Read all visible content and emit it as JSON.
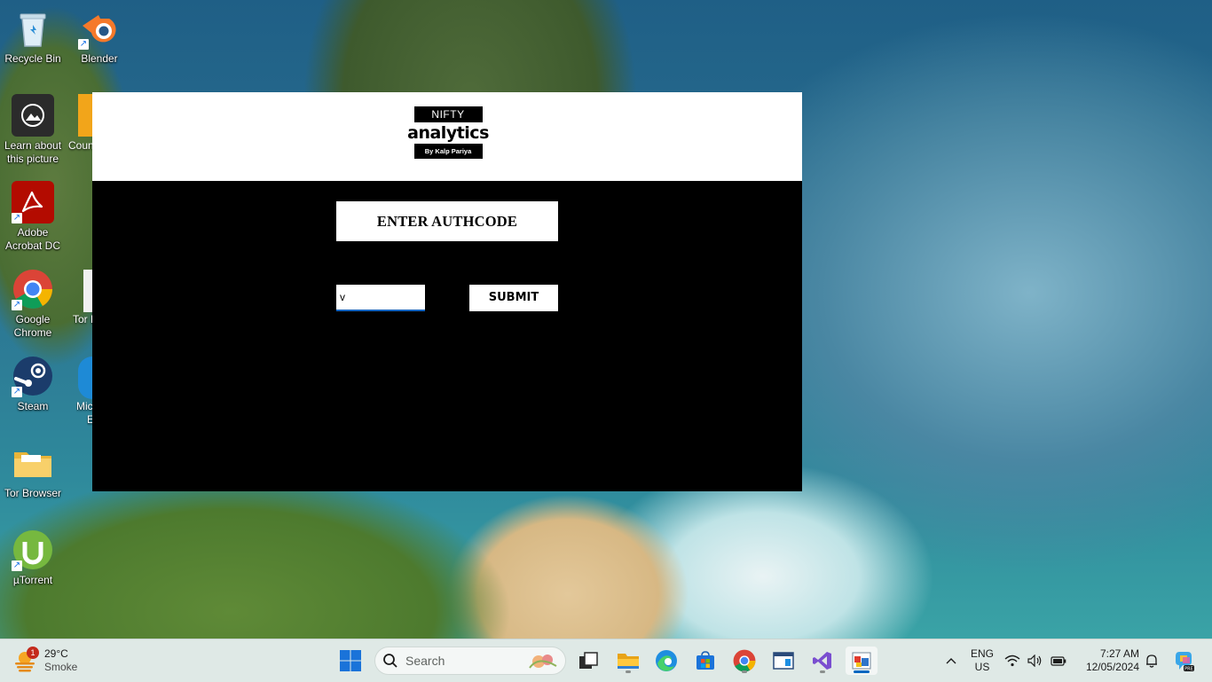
{
  "desktop": {
    "icons": [
      {
        "label": "Recycle Bin"
      },
      {
        "label": "Blender"
      },
      {
        "label": "Learn about this picture"
      },
      {
        "label": "Adobe Acrobat DC"
      },
      {
        "label": "Google Chrome"
      },
      {
        "label": "Steam"
      },
      {
        "label": "Tor Browser"
      },
      {
        "label": "µTorrent"
      }
    ],
    "partial_labels": [
      "Coun",
      "Tor B",
      "Mic",
      "E"
    ]
  },
  "app": {
    "logo": {
      "top": "NIFTY",
      "middle": "analytics",
      "bottom": "By Kalp Pariya"
    },
    "title": "ENTER AUTHCODE",
    "input_value": "v",
    "submit_label": "SUBMIT"
  },
  "taskbar": {
    "weather": {
      "badge": "1",
      "temp": "29°C",
      "condition": "Smoke"
    },
    "search_placeholder": "Search",
    "apps": [
      "task-view",
      "file-explorer",
      "edge",
      "store",
      "chrome",
      "notepad-app",
      "visual-studio",
      "python-app"
    ],
    "language": {
      "line1": "ENG",
      "line2": "US"
    },
    "clock": {
      "time": "7:27 AM",
      "date": "12/05/2024"
    }
  }
}
